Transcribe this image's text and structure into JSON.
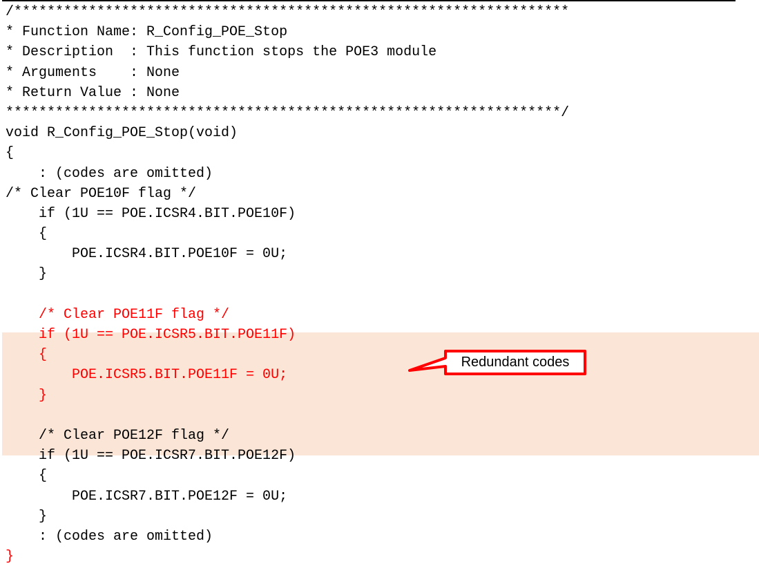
{
  "code": {
    "lines": [
      "/*******************************************************************",
      "* Function Name: R_Config_POE_Stop",
      "* Description  : This function stops the POE3 module",
      "* Arguments    : None",
      "* Return Value : None",
      "*******************************************************************/",
      "void R_Config_POE_Stop(void)",
      "{",
      "    : (codes are omitted)",
      "/* Clear POE10F flag */",
      "    if (1U == POE.ICSR4.BIT.POE10F)",
      "    {",
      "        POE.ICSR4.BIT.POE10F = 0U;",
      "    }",
      "",
      "    /* Clear POE11F flag */",
      "    if (1U == POE.ICSR5.BIT.POE11F)",
      "    {",
      "        POE.ICSR5.BIT.POE11F = 0U;",
      "    }",
      "",
      "    /* Clear POE12F flag */",
      "    if (1U == POE.ICSR7.BIT.POE12F)",
      "    {",
      "        POE.ICSR7.BIT.POE12F = 0U;",
      "    }",
      "    : (codes are omitted)",
      "}"
    ]
  },
  "callout": {
    "label": "Redundant codes"
  },
  "colors": {
    "text": "#000000",
    "highlight_text": "#ff0000",
    "highlight_background": "#fbe5d6",
    "callout_border": "#ff0000",
    "callout_fill": "#ffffff"
  }
}
